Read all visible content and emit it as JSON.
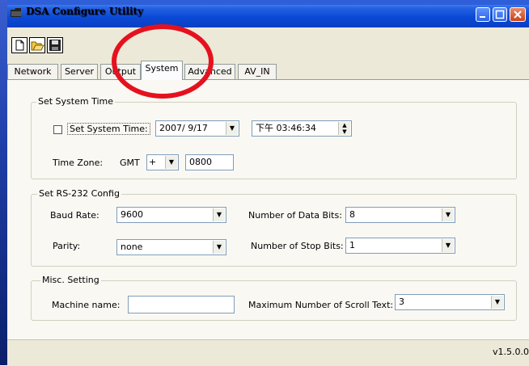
{
  "window": {
    "title": "DSA Configure Utility",
    "app_icon": "folder-icon"
  },
  "titlebar_buttons": {
    "minimize": "minimize-icon",
    "maximize": "maximize-icon",
    "close": "close-icon"
  },
  "toolbar": {
    "new_icon": "new-document-icon",
    "open_icon": "open-folder-icon",
    "save_icon": "save-disk-icon"
  },
  "tabs": [
    {
      "label": "Network"
    },
    {
      "label": "Server"
    },
    {
      "label": "Output"
    },
    {
      "label": "System",
      "active": true
    },
    {
      "label": "Advanced"
    },
    {
      "label": "AV_IN"
    }
  ],
  "system_time": {
    "group_title": "Set System Time",
    "checkbox_label": "Set System Time:",
    "checked": false,
    "date_value": "2007/ 9/17",
    "time_value": "下午 03:46:34",
    "timezone_label": "Time Zone:",
    "gmt_label": "GMT",
    "sign_value": "+",
    "offset_value": "0800"
  },
  "rs232": {
    "group_title": "Set RS-232 Config",
    "baud_label": "Baud Rate:",
    "baud_value": "9600",
    "parity_label": "Parity:",
    "parity_value": "none",
    "data_bits_label": "Number of Data Bits:",
    "data_bits_value": "8",
    "stop_bits_label": "Number of Stop Bits:",
    "stop_bits_value": "1"
  },
  "misc": {
    "group_title": "Misc. Setting",
    "machine_label": "Machine name:",
    "machine_value": "",
    "scroll_label": "Maximum Number of Scroll Text:",
    "scroll_value": "3"
  },
  "status": {
    "version": "v1.5.0.0"
  },
  "colors": {
    "titlebar": "#0a49d6",
    "annotation": "#e6111e",
    "panel": "#f9f8f3"
  }
}
